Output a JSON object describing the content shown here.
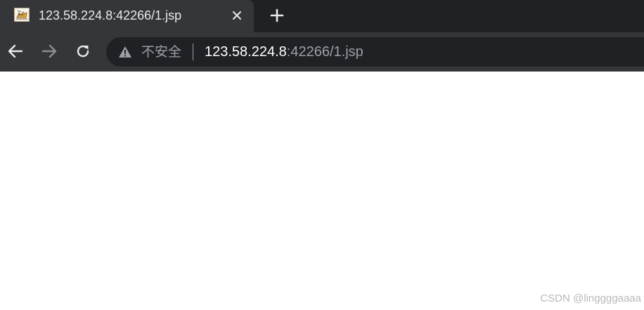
{
  "tab": {
    "title": "123.58.224.8:42266/1.jsp",
    "favicon": "tomcat-icon"
  },
  "icons": {
    "tab_close": "close-icon",
    "new_tab": "plus-icon",
    "back": "arrow-left-icon",
    "forward": "arrow-right-icon",
    "reload": "reload-icon",
    "security": "warning-icon"
  },
  "address_bar": {
    "security_label": "不安全",
    "url_host": "123.58.224.8",
    "url_rest": ":42266/1.jsp"
  },
  "page": {
    "watermark": "CSDN @linggggaaaa"
  },
  "colors": {
    "tabstrip_bg": "#202124",
    "active_tab_bg": "#35363a",
    "omnibox_bg": "#202124",
    "text_primary": "#e8eaed",
    "text_muted": "#9aa0a6"
  }
}
